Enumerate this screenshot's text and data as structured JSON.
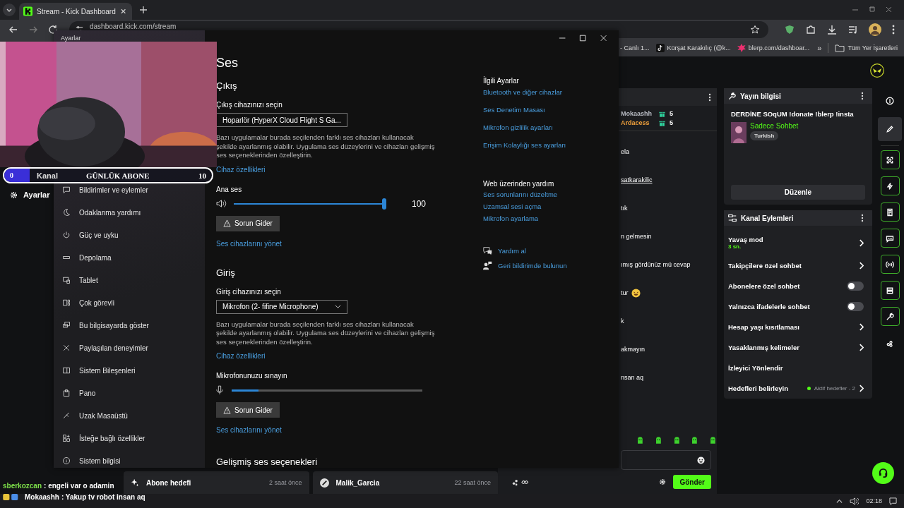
{
  "browser": {
    "tab_title": "Stream - Kick Dashboard",
    "address": "dashboard.kick.com/stream",
    "bookmarks": [
      {
        "label": "- Canlı 1..."
      },
      {
        "label": "Kürşat Karakılıç (@k..."
      },
      {
        "label": "blerp.com/dashboar..."
      }
    ],
    "bookmarks_more": "»",
    "all_bookmarks": "Tüm Yer İşaretleri"
  },
  "kick": {
    "nav_item": "Ayarlar",
    "goal_cards": [
      {
        "title": "Abone hedefi",
        "time": "2 saat önce"
      },
      {
        "title": "Malik_Garcia",
        "time": "22 saat önce"
      }
    ],
    "chat": {
      "users": [
        {
          "name": "Mokaashh",
          "color": "#b9bcc4",
          "count": "5"
        },
        {
          "name": "Ardacess",
          "color": "#f0a03c",
          "count": "5"
        }
      ],
      "messages": [
        {
          "text": "ela",
          "link": false,
          "emote": false
        },
        {
          "text": "satkarakilic",
          "link": true,
          "emote": false
        },
        {
          "text": "tık",
          "link": false,
          "emote": false
        },
        {
          "text": "n gelmesin",
          "link": false,
          "emote": false
        },
        {
          "text": "ımış gördünüz mü cevap",
          "link": false,
          "emote": false
        },
        {
          "text": "tur",
          "link": false,
          "emote": true
        },
        {
          "text": "k",
          "link": false,
          "emote": false
        },
        {
          "text": "akmayın",
          "link": false,
          "emote": false
        },
        {
          "text": "nsan aq",
          "link": false,
          "emote": false
        }
      ],
      "send": "Gönder"
    },
    "stream_info": {
      "title": "Yayın bilgisi",
      "stream_title": "DERDİNE SOqUM !donate !blerp !insta",
      "category": "Sadece Sohbet",
      "tag": "Turkish",
      "edit": "Düzenle"
    },
    "channel_actions": {
      "title": "Kanal Eylemleri",
      "items": [
        {
          "kind": "arrow",
          "label": "Yavaş mod",
          "sub": "3 sn."
        },
        {
          "kind": "arrow",
          "label": "Takipçilere özel sohbet"
        },
        {
          "kind": "toggle",
          "label": "Abonelere özel sohbet",
          "on": false
        },
        {
          "kind": "toggle",
          "label": "Yalnızca ifadelerle sohbet",
          "on": false
        },
        {
          "kind": "arrow",
          "label": "Hesap yaşı kısıtlaması"
        },
        {
          "kind": "arrow",
          "label": "Yasaklanmış kelimeler"
        },
        {
          "kind": "plain",
          "label": "İzleyici Yönlendir"
        },
        {
          "kind": "status",
          "label": "Hedefleri belirleyin",
          "status": "Aktif hedefler - 2",
          "color": "#53fc18"
        }
      ]
    },
    "rail": [
      {
        "kind": "plain",
        "selected": false
      },
      {
        "kind": "plain",
        "selected": true
      },
      {
        "kind": "boxed",
        "selected": false
      },
      {
        "kind": "boxed",
        "selected": false
      },
      {
        "kind": "boxed",
        "selected": false
      },
      {
        "kind": "boxed",
        "selected": false
      },
      {
        "kind": "boxed",
        "selected": false
      },
      {
        "kind": "boxed",
        "selected": false
      },
      {
        "kind": "boxed",
        "selected": false
      },
      {
        "kind": "plain",
        "selected": false
      }
    ]
  },
  "settings_window": {
    "title": "Ayarlar",
    "sidebar": [
      "Bildirimler ve eylemler",
      "Odaklanma yardımı",
      "Güç ve uyku",
      "Depolama",
      "Tablet",
      "Çok görevli",
      "Bu bilgisayarda göster",
      "Paylaşılan deneyimler",
      "Sistem Bileşenleri",
      "Pano",
      "Uzak Masaüstü",
      "İsteğe bağlı özellikler",
      "Sistem bilgisi"
    ],
    "page_title": "Ses",
    "sections": [
      {
        "kind": "output",
        "heading": "Çıkış",
        "device_label": "Çıkış cihazınızı seçin",
        "device": "Hoparlör (HyperX Cloud Flight S Ga...",
        "note": "Bazı uygulamalar burada seçilenden farklı ses cihazları kullanacak şekilde ayarlanmış olabilir. Uygulama ses düzeylerini ve cihazları gelişmiş ses seçeneklerinden özelleştirin.",
        "properties": "Cihaz özellikleri",
        "level_label": "Ana ses",
        "level": 1.0,
        "reading": "100",
        "troubleshoot": "Sorun Gider",
        "manage": "Ses cihazlarını yönet"
      },
      {
        "kind": "input",
        "heading": "Giriş",
        "device_label": "Giriş cihazınızı seçin",
        "device": "Mikrofon (2- fifine Microphone)",
        "note": "Bazı uygulamalar burada seçilenden farklı ses cihazları kullanacak şekilde ayarlanmış olabilir. Uygulama ses düzeylerini ve cihazları gelişmiş ses seçeneklerinden özelleştirin.",
        "properties": "Cihaz özellikleri",
        "level_label": "Mikrofonunuzu sınayın",
        "level": 0.14,
        "troubleshoot": "Sorun Gider",
        "manage": "Ses cihazlarını yönet"
      }
    ],
    "advanced": "Gelişmiş ses seçenekleri",
    "related_title": "İlgili Ayarlar",
    "related": [
      "Bluetooth ve diğer cihazlar",
      "Ses Denetim Masası",
      "Mikrofon gizlilik ayarları",
      "Erişim Kolaylığı ses ayarları"
    ],
    "web_title": "Web üzerinden yardım",
    "web": [
      "Ses sorunlarını düzeltme",
      "Uzamsal sesi açma",
      "Mikrofon ayarlama"
    ],
    "help": [
      "Yardım al",
      "Geri bildirimde bulunun"
    ]
  },
  "overlay": {
    "left_count": "0",
    "channel": "Kanal",
    "goal_title": "GÜNLÜK ABONE",
    "goal_count": "10"
  },
  "overlay_chat": [
    {
      "user": "sberkozcan",
      "color": "#7ee04a",
      "text": ": engeli var o adamin",
      "badged": false
    },
    {
      "user": "Mokaashh",
      "color": "#ffffff",
      "text": ": Yakup tv robot insan aq",
      "badged": true
    }
  ],
  "taskbar": {
    "time": "02:18"
  }
}
